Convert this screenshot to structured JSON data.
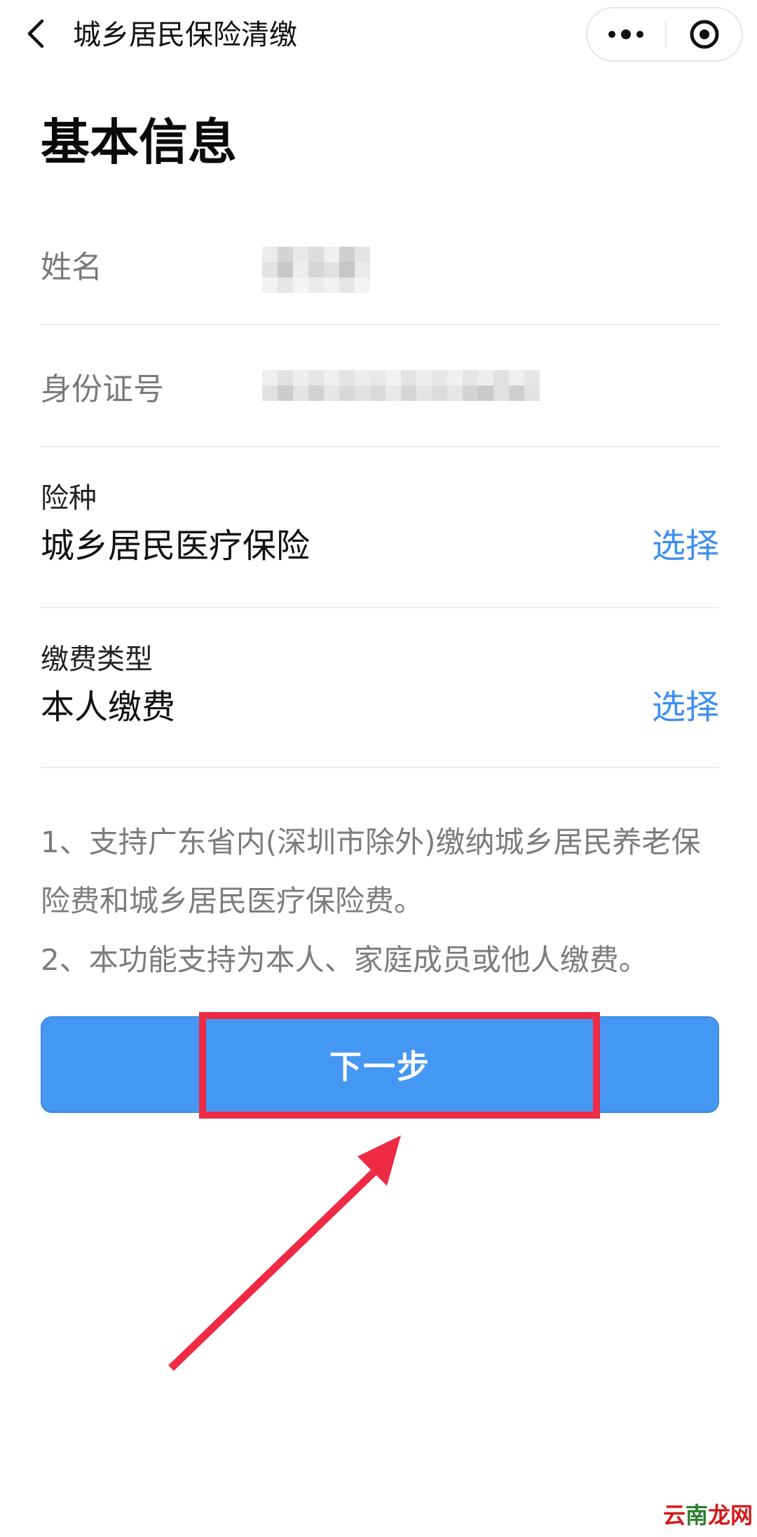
{
  "navbar": {
    "title": "城乡居民保险清缴",
    "back_icon": "chevron-left-icon",
    "more_icon": "more-dots-icon",
    "close_icon": "target-circle-icon"
  },
  "section": {
    "title": "基本信息"
  },
  "form": {
    "name": {
      "label": "姓名"
    },
    "id_number": {
      "label": "身份证号"
    },
    "insurance_type": {
      "label": "险种",
      "value": "城乡居民医疗保险",
      "action": "选择"
    },
    "payment_type": {
      "label": "缴费类型",
      "value": "本人缴费",
      "action": "选择"
    }
  },
  "notes": [
    "1、支持广东省内(深圳市除外)缴纳城乡居民养老保险费和城乡居民医疗保险费。",
    "2、本功能支持为本人、家庭成员或他人缴费。"
  ],
  "next_button": {
    "label": "下一步"
  },
  "watermark": {
    "part1": "云",
    "part2": "南",
    "part3": "龙网"
  },
  "colors": {
    "accent": "#4497f3",
    "link": "#3f8ff0",
    "highlight": "#ee2a45"
  }
}
